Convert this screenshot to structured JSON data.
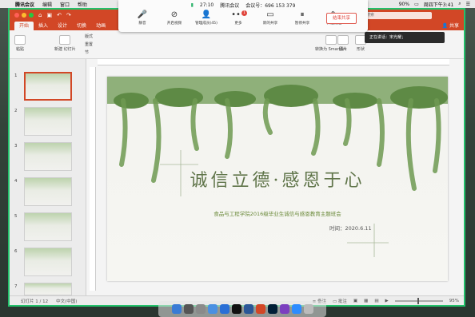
{
  "menubar": {
    "app_name": "腾讯会议",
    "items": [
      "编辑",
      "窗口",
      "帮助"
    ],
    "battery": "90%",
    "clock": "周四下午3:41"
  },
  "ppt": {
    "search_placeholder": "在演示文稿中搜索",
    "tabs": [
      "开始",
      "插入",
      "设计",
      "切换",
      "动画"
    ],
    "share": "共享",
    "ribbon": {
      "paste": "粘贴",
      "new_slide": "新建\n幻灯片",
      "layout": "版式",
      "reset": "重置",
      "section": "节",
      "picture": "图片",
      "shape": "形状",
      "convert": "转换为\nSmartArt"
    },
    "tooltip": "正在讲话：宋光耀；"
  },
  "meeting": {
    "timer": "27:10",
    "title": "腾讯会议",
    "meeting_id_label": "会议号：",
    "meeting_id": "696 153 379",
    "buttons": [
      {
        "label": "静音",
        "icon": "mic-icon"
      },
      {
        "label": "开启视频",
        "icon": "video-off-icon"
      },
      {
        "label": "管理成员(45)",
        "icon": "members-icon"
      },
      {
        "label": "更多",
        "icon": "more-icon"
      },
      {
        "label": "新的共享",
        "icon": "share-screen-icon"
      },
      {
        "label": "暂停共享",
        "icon": "pause-icon"
      },
      {
        "label": "开启批注",
        "icon": "annotate-icon"
      }
    ],
    "badge": "1",
    "end_share": "结束共享"
  },
  "thumbnails": [
    "1",
    "2",
    "3",
    "4",
    "5",
    "6",
    "7"
  ],
  "slide": {
    "title": "诚信立德·感恩于心",
    "subtitle": "食品与工程学院2016级毕业生诚信与感恩教育主题班会",
    "date": "时间：2020.6.11"
  },
  "status": {
    "slide_count": "幻灯片 1 / 12",
    "language": "中文(中国)",
    "notes": "备注",
    "comments": "批注",
    "zoom": "95%"
  },
  "colors": {
    "ppt_accent": "#d24726",
    "meeting_frame": "#23c16b",
    "title_green": "#5f7449"
  }
}
